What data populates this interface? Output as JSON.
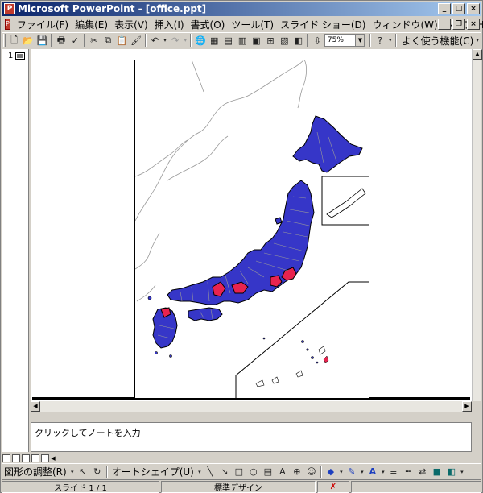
{
  "window": {
    "title": "Microsoft PowerPoint - [office.ppt]"
  },
  "menu": [
    {
      "label": "ファイル(F)"
    },
    {
      "label": "編集(E)"
    },
    {
      "label": "表示(V)"
    },
    {
      "label": "挿入(I)"
    },
    {
      "label": "書式(O)"
    },
    {
      "label": "ツール(T)"
    },
    {
      "label": "スライド ショー(D)"
    },
    {
      "label": "ウィンドウ(W)"
    },
    {
      "label": "ヘルプ(H)"
    }
  ],
  "toolbar": {
    "zoom_value": "75%",
    "frequent_features": "よく使う機能(C)"
  },
  "thumbnails": {
    "slide_number": "1"
  },
  "notes": {
    "placeholder": "クリックしてノートを入力"
  },
  "drawing": {
    "adjust_label": "図形の調整(R)",
    "autoshape_label": "オートシェイプ(U)"
  },
  "status": {
    "slide_info": "スライド 1 / 1",
    "design": "標準デザイン"
  },
  "map": {
    "prefecture_fill": "#3636c8",
    "highlight_fill": "#e8234f",
    "border_color": "#9a9a9a"
  }
}
